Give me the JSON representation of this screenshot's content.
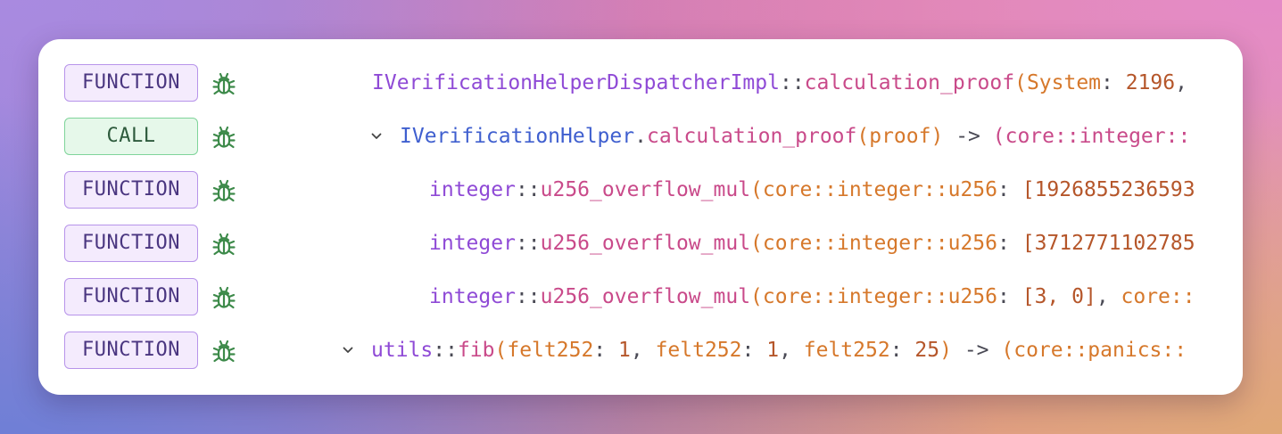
{
  "colors": {
    "badge_function_border": "#b794ea",
    "badge_function_bg": "#f4ebfd",
    "badge_call_border": "#7fd49a",
    "badge_call_bg": "#e6f8ea",
    "bug_icon": "#3d8a4a"
  },
  "rows": [
    {
      "badge": "FUNCTION",
      "icon": "bug-icon",
      "expand": false,
      "tokens": [
        {
          "t": "IVerificationHelperDispatcherImpl",
          "c": "purple"
        },
        {
          "t": "::",
          "c": "gray"
        },
        {
          "t": "calculation_proof",
          "c": "pink"
        },
        {
          "t": "(",
          "c": "orange"
        },
        {
          "t": "System",
          "c": "orange"
        },
        {
          "t": ": ",
          "c": "gray"
        },
        {
          "t": "2196",
          "c": "brown"
        },
        {
          "t": ", ",
          "c": "gray"
        }
      ]
    },
    {
      "badge": "CALL",
      "icon": "bug-icon",
      "expand": true,
      "tokens": [
        {
          "t": "IVerificationHelper",
          "c": "blue"
        },
        {
          "t": ".",
          "c": "gray"
        },
        {
          "t": "calculation_proof",
          "c": "pink"
        },
        {
          "t": "(",
          "c": "orange"
        },
        {
          "t": "proof",
          "c": "orange"
        },
        {
          "t": ") ",
          "c": "orange"
        },
        {
          "t": "-> ",
          "c": "gray"
        },
        {
          "t": "(",
          "c": "pink"
        },
        {
          "t": "core::integer::",
          "c": "pink"
        }
      ]
    },
    {
      "badge": "FUNCTION",
      "icon": "bug-icon",
      "expand": false,
      "tokens": [
        {
          "t": "integer",
          "c": "purple"
        },
        {
          "t": "::",
          "c": "gray"
        },
        {
          "t": "u256_overflow_mul",
          "c": "pink"
        },
        {
          "t": "(",
          "c": "orange"
        },
        {
          "t": "core::integer::u256",
          "c": "orange"
        },
        {
          "t": ": ",
          "c": "gray"
        },
        {
          "t": "[1926855236593",
          "c": "brown"
        }
      ]
    },
    {
      "badge": "FUNCTION",
      "icon": "bug-icon",
      "expand": false,
      "tokens": [
        {
          "t": "integer",
          "c": "purple"
        },
        {
          "t": "::",
          "c": "gray"
        },
        {
          "t": "u256_overflow_mul",
          "c": "pink"
        },
        {
          "t": "(",
          "c": "orange"
        },
        {
          "t": "core::integer::u256",
          "c": "orange"
        },
        {
          "t": ": ",
          "c": "gray"
        },
        {
          "t": "[3712771102785",
          "c": "brown"
        }
      ]
    },
    {
      "badge": "FUNCTION",
      "icon": "bug-icon",
      "expand": false,
      "tokens": [
        {
          "t": "integer",
          "c": "purple"
        },
        {
          "t": "::",
          "c": "gray"
        },
        {
          "t": "u256_overflow_mul",
          "c": "pink"
        },
        {
          "t": "(",
          "c": "orange"
        },
        {
          "t": "core::integer::u256",
          "c": "orange"
        },
        {
          "t": ": ",
          "c": "gray"
        },
        {
          "t": "[3, 0]",
          "c": "brown"
        },
        {
          "t": ", ",
          "c": "gray"
        },
        {
          "t": "core::",
          "c": "orange"
        }
      ]
    },
    {
      "badge": "FUNCTION",
      "icon": "bug-icon",
      "expand": true,
      "tokens": [
        {
          "t": "utils",
          "c": "purple"
        },
        {
          "t": "::",
          "c": "gray"
        },
        {
          "t": "fib",
          "c": "pink"
        },
        {
          "t": "(",
          "c": "orange"
        },
        {
          "t": "felt252",
          "c": "orange"
        },
        {
          "t": ": ",
          "c": "gray"
        },
        {
          "t": "1",
          "c": "brown"
        },
        {
          "t": ", ",
          "c": "gray"
        },
        {
          "t": "felt252",
          "c": "orange"
        },
        {
          "t": ": ",
          "c": "gray"
        },
        {
          "t": "1",
          "c": "brown"
        },
        {
          "t": ", ",
          "c": "gray"
        },
        {
          "t": "felt252",
          "c": "orange"
        },
        {
          "t": ": ",
          "c": "gray"
        },
        {
          "t": "25",
          "c": "brown"
        },
        {
          "t": ") ",
          "c": "orange"
        },
        {
          "t": "-> ",
          "c": "gray"
        },
        {
          "t": "(",
          "c": "orange"
        },
        {
          "t": "core::panics::",
          "c": "orange"
        }
      ]
    }
  ]
}
